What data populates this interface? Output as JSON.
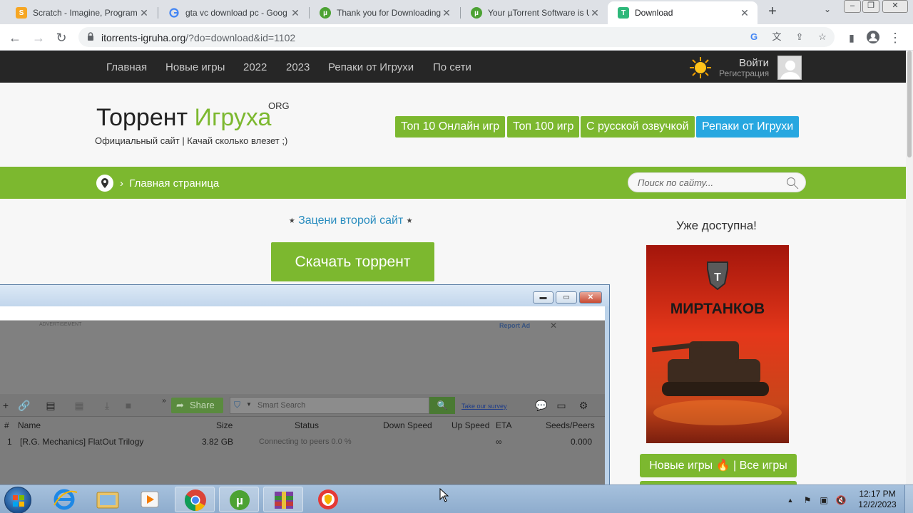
{
  "browser": {
    "tabs": [
      {
        "title": "Scratch - Imagine, Program",
        "icon": "scratch-icon",
        "active": false
      },
      {
        "title": "gta vc download pc - Goog",
        "icon": "google-icon",
        "active": false
      },
      {
        "title": "Thank you for Downloading",
        "icon": "utorrent-icon",
        "active": false
      },
      {
        "title": "Your µTorrent Software is U",
        "icon": "utorrent-icon",
        "active": false
      },
      {
        "title": "Download",
        "icon": "igruha-icon",
        "active": true
      }
    ],
    "url_host": "itorrents-igruha.org",
    "url_path": "/?do=download&id=1102"
  },
  "site": {
    "nav": [
      "Главная",
      "Новые игры",
      "2022",
      "2023",
      "Репаки от Игрухи",
      "По сети"
    ],
    "login": "Войти",
    "register": "Регистрация",
    "logo_part1": "Торрент ",
    "logo_part2": "Игруха",
    "logo_suffix": "ORG",
    "tagline": "Официальный сайт | Качай сколько влезет ;)",
    "header_buttons": [
      "Топ 10 Онлайн игр",
      "Топ 100 игр",
      "С русской озвучкой",
      "Репаки от Игрухи"
    ],
    "breadcrumb": "Главная страница",
    "search_placeholder": "Поиск по сайту...",
    "rate_prefix": "⭑ ",
    "rate_link": "Зацени второй сайт",
    "rate_suffix": " ⭑",
    "download_button": "Скачать торрент",
    "available_label": "Уже доступна!",
    "banner_text": "МИРТАНКОВ",
    "new_games_button": "Новые игры 🔥 | Все игры"
  },
  "utorrent": {
    "ad_label": "ADVERTISEMENT",
    "report_ad": "Report Ad",
    "share_label": "Share",
    "search_placeholder": "Smart Search",
    "survey_link": "Take our survey",
    "columns": [
      "#",
      "Name",
      "Size",
      "Status",
      "Down Speed",
      "Up Speed",
      "ETA",
      "Seeds/Peers"
    ],
    "rows": [
      {
        "num": "1",
        "name": "[R.G. Mechanics] FlatOut Trilogy",
        "size": "3.82 GB",
        "status": "Connecting to peers 0.0 %",
        "down": "",
        "up": "",
        "eta": "∞",
        "seeds": "0.000"
      }
    ]
  },
  "taskbar": {
    "time": "12:17 PM",
    "date": "12/2/2023"
  },
  "colors": {
    "site_green": "#7cb82f",
    "site_blue": "#27a7e0",
    "nav_dark": "#262626"
  }
}
